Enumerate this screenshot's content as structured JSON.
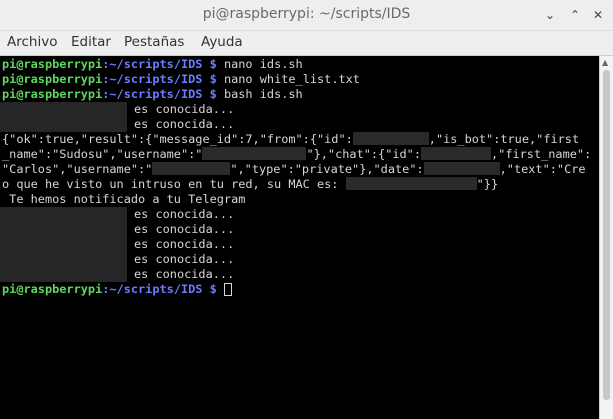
{
  "window": {
    "title": "pi@raspberrypi: ~/scripts/IDS",
    "buttons": {
      "minimize": "⌄",
      "maximize": "⌃",
      "close": "✕"
    }
  },
  "menu": [
    "Archivo",
    "Editar",
    "Pestañas",
    "Ayuda"
  ],
  "prompt": {
    "user": "pi@raspberrypi",
    "path": ":~/scripts/IDS",
    "dollar": " $ "
  },
  "commands": [
    "nano ids.sh",
    "nano white_list.txt",
    "bash ids.sh"
  ],
  "output": {
    "known": "es conocida...",
    "json_lines": [
      "{\"ok\":true,\"result\":{\"message_id\":7,\"from\":{\"id\":",
      ",\"is_bot\":true,\"first",
      "_name\":\"Sudosu\",\"username\":\"",
      "\"},\"chat\":{\"id\":",
      ",\"first_name\":",
      "\"Carlos\",\"username\":\"",
      "\",\"type\":\"private\"},\"date\":",
      ",\"text\":\"Cre",
      "o que he visto un intruso en tu red, su MAC es: ",
      "\"}}"
    ],
    "notified": " Te hemos notificado a tu Telegram"
  },
  "colors": {
    "prompt_user": "#5fd75f",
    "prompt_path": "#6b7dff",
    "text": "#d6d6d6",
    "background": "#000000"
  }
}
